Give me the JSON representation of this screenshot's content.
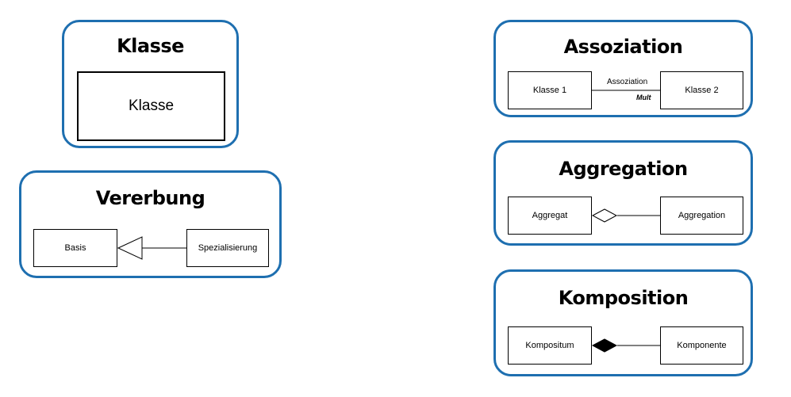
{
  "cards": {
    "klasse": {
      "title": "Klasse",
      "box_label": "Klasse"
    },
    "vererbung": {
      "title": "Vererbung",
      "left_label": "Basis",
      "right_label": "Spezialisierung",
      "relation": "inheritance"
    },
    "assoziation": {
      "title": "Assoziation",
      "left_label": "Klasse 1",
      "right_label": "Klasse 2",
      "line_label": "Assoziation",
      "multiplicity_label": "Mult",
      "relation": "association"
    },
    "aggregation": {
      "title": "Aggregation",
      "left_label": "Aggregat",
      "right_label": "Aggregation",
      "relation": "aggregation"
    },
    "komposition": {
      "title": "Komposition",
      "left_label": "Kompositum",
      "right_label": "Komponente",
      "relation": "composition"
    }
  },
  "colors": {
    "card_border": "#1e6fb0",
    "line": "#000000",
    "background": "#ffffff"
  }
}
